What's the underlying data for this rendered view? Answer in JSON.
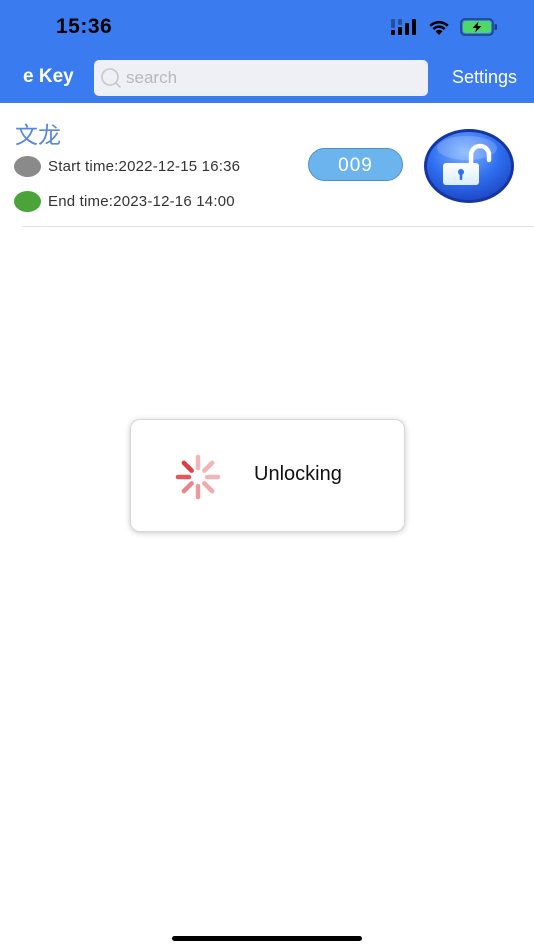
{
  "status_bar": {
    "time": "15:36",
    "icons": [
      "signal-icon",
      "wifi-icon",
      "battery-charging-icon"
    ]
  },
  "header": {
    "title": "e Key",
    "search_placeholder": "search",
    "search_value": "",
    "settings_label": "Settings",
    "background_color": "#3a7cf0"
  },
  "key_item": {
    "name": "文龙",
    "start_label": "Start time:",
    "start_time": "2022-12-15 16:36",
    "start_text": "Start time:2022-12-15 16:36",
    "end_label": "End time:",
    "end_time": "2023-12-16 14:00",
    "end_text": "End time:2023-12-16 14:00",
    "id_badge": "009",
    "start_dot_color": "#8a8a8a",
    "end_dot_color": "#4aa43a",
    "unlock_icon": "unlock-padlock-icon"
  },
  "toast": {
    "message": "Unlocking",
    "icon": "loading-spinner-icon"
  }
}
